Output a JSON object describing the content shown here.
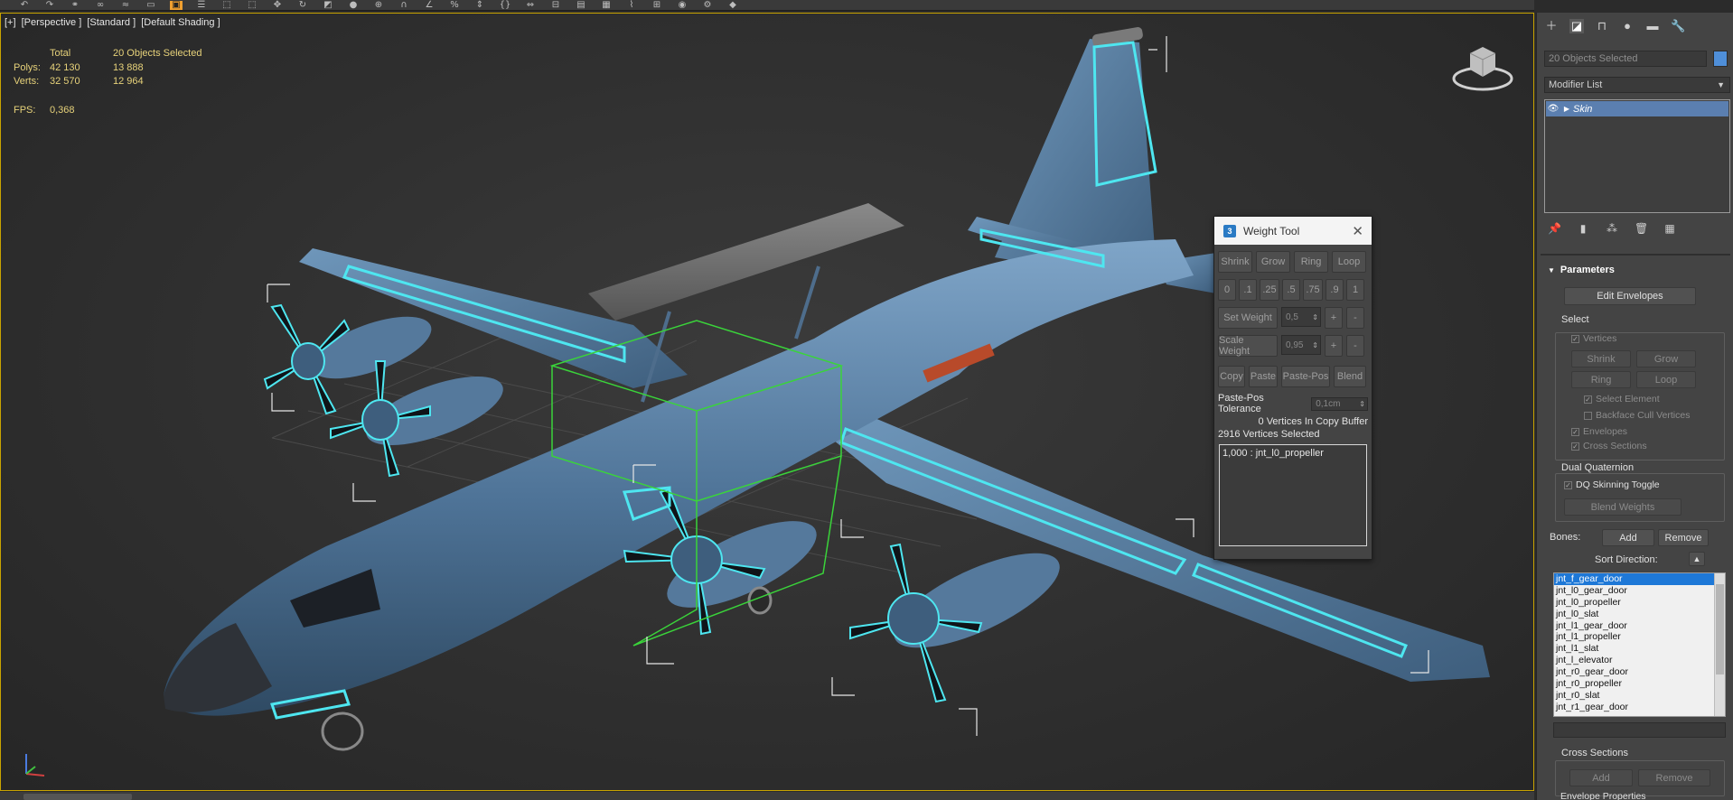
{
  "viewport": {
    "label_parts": [
      "[+]",
      "[Perspective ]",
      "[Standard ]",
      "[Default Shading ]"
    ],
    "stats": {
      "header_total": "Total",
      "header_selected": "20 Objects Selected",
      "polys_label": "Polys:",
      "polys_total": "42 130",
      "polys_selected": "13 888",
      "verts_label": "Verts:",
      "verts_total": "32 570",
      "verts_selected": "12 964",
      "fps_label": "FPS:",
      "fps_value": "0,368"
    },
    "colors": {
      "stats_text": "#e7d27a",
      "viewport_border": "#c9a400",
      "selection_outline": "#4ee6f0",
      "selection_box": "#3ad43a"
    }
  },
  "weight_tool": {
    "title": "Weight Tool",
    "buttons_row1": [
      "Shrink",
      "Grow",
      "Ring",
      "Loop"
    ],
    "presets": [
      "0",
      ".1",
      ".25",
      ".5",
      ".75",
      ".9",
      "1"
    ],
    "set_weight_label": "Set Weight",
    "set_weight_value": "0,5",
    "scale_weight_label": "Scale Weight",
    "scale_weight_value": "0,95",
    "plus": "+",
    "minus": "-",
    "buttons_row4": [
      "Copy",
      "Paste",
      "Paste-Pos",
      "Blend"
    ],
    "paste_pos_label": "Paste-Pos Tolerance",
    "paste_pos_value": "0,1cm",
    "copy_buffer_text": "0 Vertices In Copy Buffer",
    "selected_text": "2916 Vertices Selected",
    "weights_list": [
      "1,000 : jnt_l0_propeller"
    ]
  },
  "panel": {
    "object_name": "20 Objects Selected",
    "object_color": "#4f8fd9",
    "modifier_list": "Modifier List",
    "stack_item": "Skin",
    "parameters_title": "Parameters",
    "edit_envelopes": "Edit Envelopes",
    "select_group": "Select",
    "vertices": "Vertices",
    "shrink": "Shrink",
    "grow": "Grow",
    "ring": "Ring",
    "loop": "Loop",
    "select_element": "Select Element",
    "backface_cull": "Backface Cull Vertices",
    "envelopes": "Envelopes",
    "cross_sections": "Cross Sections",
    "dual_quaternion": "Dual Quaternion",
    "dq_toggle": "DQ Skinning Toggle",
    "blend_weights": "Blend Weights",
    "bones_label": "Bones:",
    "add": "Add",
    "remove": "Remove",
    "sort_direction": "Sort Direction:",
    "bones": [
      "jnt_f_gear_door",
      "jnt_l0_gear_door",
      "jnt_l0_propeller",
      "jnt_l0_slat",
      "jnt_l1_gear_door",
      "jnt_l1_propeller",
      "jnt_l1_slat",
      "jnt_l_elevator",
      "jnt_r0_gear_door",
      "jnt_r0_propeller",
      "jnt_r0_slat",
      "jnt_r1_gear_door"
    ],
    "cross_sections_group": "Cross Sections",
    "cs_add": "Add",
    "cs_remove": "Remove",
    "envelope_properties": "Envelope Properties"
  }
}
